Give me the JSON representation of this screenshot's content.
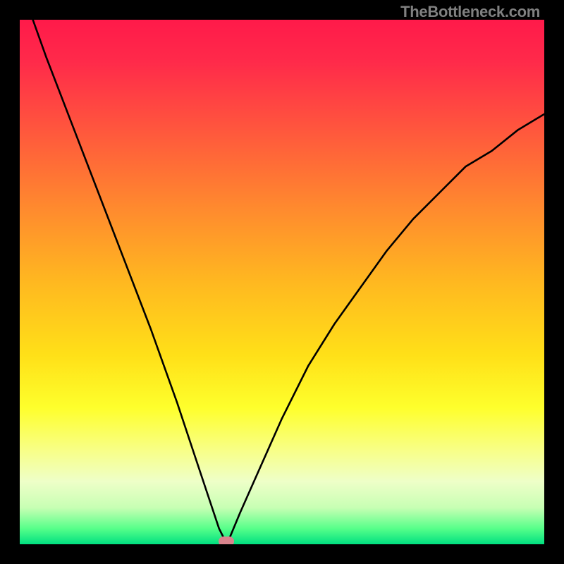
{
  "watermark_text": "TheBottleneck.com",
  "marker": {
    "x_frac": 0.394,
    "y_frac": 0.994,
    "color": "#d9848d"
  },
  "chart_data": {
    "type": "line",
    "title": "",
    "xlabel": "",
    "ylabel": "",
    "xlim": [
      0,
      1
    ],
    "ylim": [
      0,
      1
    ],
    "series": [
      {
        "name": "left-branch",
        "x": [
          0.025,
          0.05,
          0.1,
          0.15,
          0.2,
          0.25,
          0.3,
          0.33,
          0.36,
          0.38,
          0.395
        ],
        "y": [
          1.0,
          0.93,
          0.8,
          0.67,
          0.54,
          0.41,
          0.27,
          0.18,
          0.09,
          0.03,
          0.0
        ]
      },
      {
        "name": "right-branch",
        "x": [
          0.395,
          0.42,
          0.46,
          0.5,
          0.55,
          0.6,
          0.65,
          0.7,
          0.75,
          0.8,
          0.85,
          0.9,
          0.95,
          1.0
        ],
        "y": [
          0.0,
          0.06,
          0.15,
          0.24,
          0.34,
          0.42,
          0.49,
          0.56,
          0.62,
          0.67,
          0.72,
          0.75,
          0.79,
          0.82
        ]
      }
    ],
    "annotations": [
      {
        "name": "optimal-marker",
        "x": 0.394,
        "y": 0.006
      }
    ]
  }
}
